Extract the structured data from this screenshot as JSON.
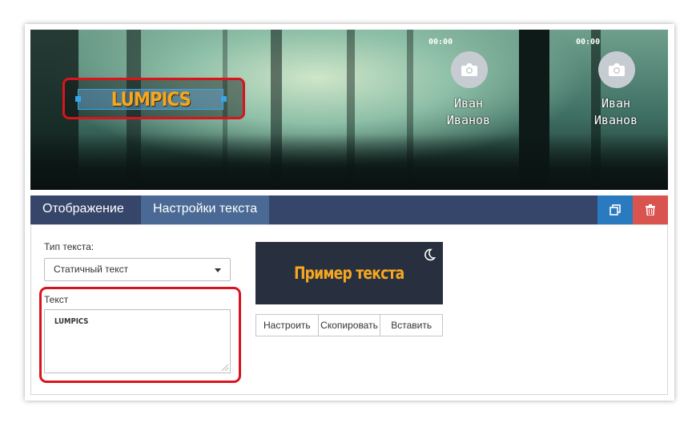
{
  "banner": {
    "logo_text": "LUMPICS",
    "profiles": [
      {
        "time": "00:00",
        "name_first": "Иван",
        "name_last": "Иванов"
      },
      {
        "time": "00:00",
        "name_first": "Иван",
        "name_last": "Иванов"
      }
    ]
  },
  "tabs": [
    {
      "label": "Отображение",
      "active": false
    },
    {
      "label": "Настройки текста",
      "active": true
    }
  ],
  "toolbar": {
    "copy_icon": "copy-icon",
    "delete_icon": "trash-icon",
    "copy_color": "#2a7ac0",
    "delete_color": "#d9534f"
  },
  "form": {
    "text_type_label": "Тип текста:",
    "text_type_value": "Статичный текст",
    "text_label": "Текст",
    "text_value": "LUMPICS"
  },
  "preview": {
    "sample_text": "Пример текста",
    "moon_icon": "moon-icon"
  },
  "actions": {
    "configure": "Настроить",
    "copy": "Скопировать",
    "paste": "Вставить"
  },
  "colors": {
    "tabbar": "#36456a",
    "tab_active": "#4a6a95",
    "highlight": "#d9141c",
    "accent_text": "#f6a71f"
  }
}
